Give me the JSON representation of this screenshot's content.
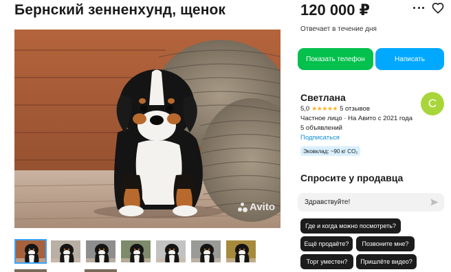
{
  "listing": {
    "title": "Бернский зенненхунд, щенок",
    "price": "120 000 ₽",
    "response_time": "Отвечает в течение дня"
  },
  "actions": {
    "show_phone": "Показать телефон",
    "write": "Написать"
  },
  "seller": {
    "name": "Светлана",
    "rating": "5,0",
    "stars": "★★★★★",
    "reviews": "5 отзывов",
    "type_since": "Частное лицо · На Авито с 2021 года",
    "listings": "5 объявлений",
    "subscribe": "Подписаться",
    "eco": "Эковклад: ~90 кг CO₂",
    "avatar_letter": "С",
    "avatar_color": "#a8d63a"
  },
  "ask": {
    "title": "Спросите у продавца",
    "input_value": "Здравствуйте!",
    "chips": [
      "Где и когда можно посмотреть?",
      "Ещё продаёте?",
      "Позвоните мне?",
      "Торг уместен?",
      "Пришлёте видео?"
    ]
  },
  "gallery": {
    "watermark": "Avito",
    "thumb_count": 7,
    "active_index": 0
  },
  "colors": {
    "green": "#04c04d",
    "blue": "#00a8ff",
    "link": "#0a8bd9",
    "star": "#ffb021"
  }
}
